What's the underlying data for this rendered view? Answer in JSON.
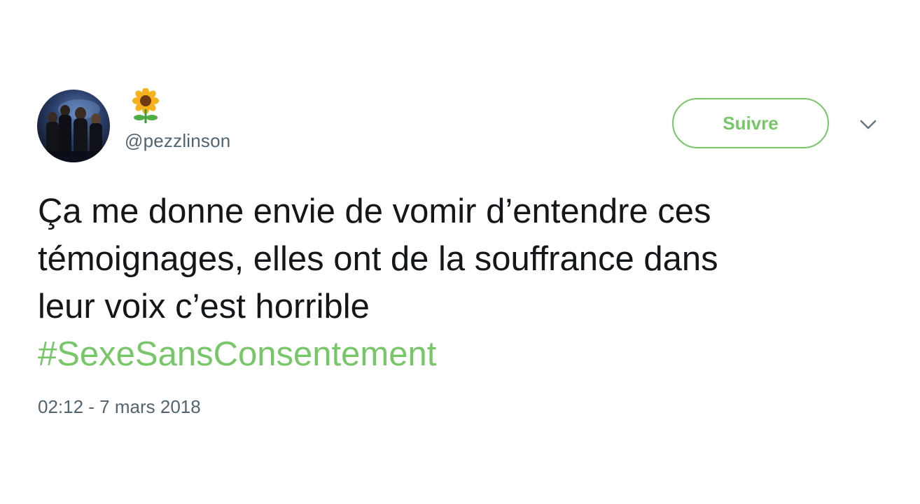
{
  "user": {
    "display_name_icon": "sunflower-icon",
    "handle": "@pezzlinson",
    "avatar_icon": "avatar-photo"
  },
  "follow_button": {
    "label": "Suivre"
  },
  "menu": {
    "icon": "chevron-down-icon"
  },
  "tweet": {
    "lines": [
      "Ça me donne envie de vomir d’entendre ces",
      "témoignages, elles ont de la souffrance dans",
      "leur voix c’est horrible"
    ],
    "hashtag": "#SexeSansConsentement",
    "timestamp": "02:12 - 7 mars 2018"
  },
  "colors": {
    "accent": "#77c768",
    "text": "#14171a",
    "secondary": "#536471"
  }
}
